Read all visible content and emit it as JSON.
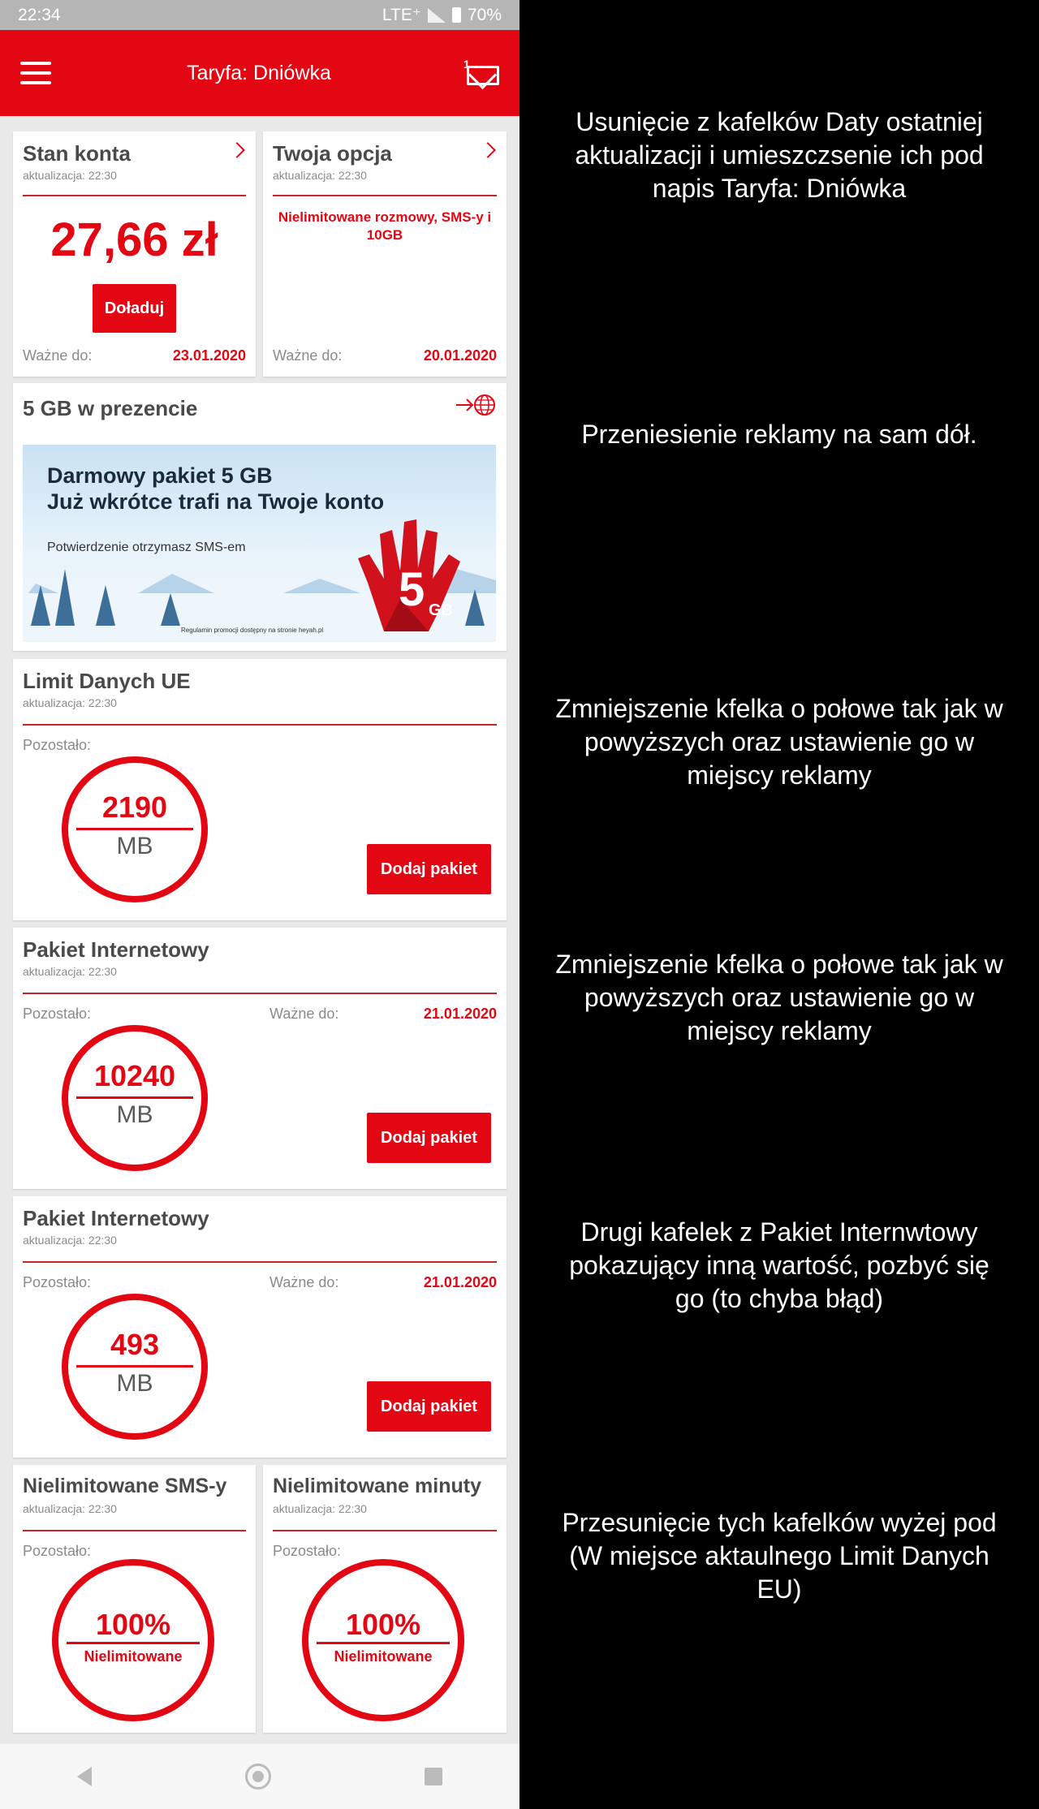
{
  "status_bar": {
    "time": "22:34",
    "network": "LTE⁺",
    "battery": "70%"
  },
  "app_bar": {
    "title": "Taryfa: Dniówka",
    "mail_badge": "1"
  },
  "account_card": {
    "title": "Stan konta",
    "updated": "aktualizacja: 22:30",
    "balance": "27,66 zł",
    "topup_button": "Doładuj",
    "valid_label": "Ważne do:",
    "valid_date": "23.01.2020"
  },
  "option_card": {
    "title": "Twoja opcja",
    "updated": "aktualizacja: 22:30",
    "description": "Nielimitowane rozmowy, SMS-y i 10GB",
    "valid_label": "Ważne do:",
    "valid_date": "20.01.2020"
  },
  "promo_card": {
    "title": "5 GB w prezencie",
    "headline_1": "Darmowy pakiet 5 GB",
    "headline_2": "Już wkrótce trafi na Twoje konto",
    "body": "Potwierdzenie otrzymasz SMS-em",
    "badge_big": "5",
    "badge_small": "GB",
    "fine_print": "Regulamin promocji dostępny na stronie heyah.pl"
  },
  "eu_card": {
    "title": "Limit Danych UE",
    "updated": "aktualizacja: 22:30",
    "remaining_label": "Pozostało:",
    "value": "2190",
    "unit": "MB",
    "button": "Dodaj pakiet"
  },
  "internet_card_1": {
    "title": "Pakiet Internetowy",
    "updated": "aktualizacja: 22:30",
    "remaining_label": "Pozostało:",
    "valid_label": "Ważne do:",
    "valid_date": "21.01.2020",
    "value": "10240",
    "unit": "MB",
    "button": "Dodaj pakiet"
  },
  "internet_card_2": {
    "title": "Pakiet Internetowy",
    "updated": "aktualizacja: 22:30",
    "remaining_label": "Pozostało:",
    "valid_label": "Ważne do:",
    "valid_date": "21.01.2020",
    "value": "493",
    "unit": "MB",
    "button": "Dodaj pakiet"
  },
  "sms_card": {
    "title": "Nielimitowane SMS-y",
    "updated": "aktualizacja: 22:30",
    "remaining_label": "Pozostało:",
    "value": "100%",
    "unit": "Nielimitowane"
  },
  "minutes_card": {
    "title": "Nielimitowane minuty",
    "updated": "aktualizacja: 22:30",
    "remaining_label": "Pozostało:",
    "value": "100%",
    "unit": "Nielimitowane"
  },
  "notes": [
    "Usunięcie z kafelków Daty ostatniej aktualizacji i umieszczsenie ich pod napis Taryfa: Dniówka",
    "Przeniesienie reklamy na sam dół.",
    "Zmniejszenie kfelka o połowe tak jak w powyższych oraz ustawienie go w miejscy reklamy",
    "Zmniejszenie kfelka o połowe tak jak w powyższych oraz ustawienie go w miejscy reklamy",
    "Drugi kafelek z Pakiet Internwtowy pokazujący inną wartość, pozbyć się go (to chyba błąd)",
    "Przesunięcie tych kafelków wyżej pod (W miejsce aktaulnego Limit Danych EU)"
  ],
  "colors": {
    "brand_red": "#e30613",
    "status_bar": "#b5b5b5",
    "background": "#e9e9e9",
    "icons": [
      "hamburger-icon",
      "mail-icon",
      "chevron-right-icon",
      "globe-arrow-icon",
      "back-icon",
      "home-icon",
      "recents-icon"
    ]
  }
}
